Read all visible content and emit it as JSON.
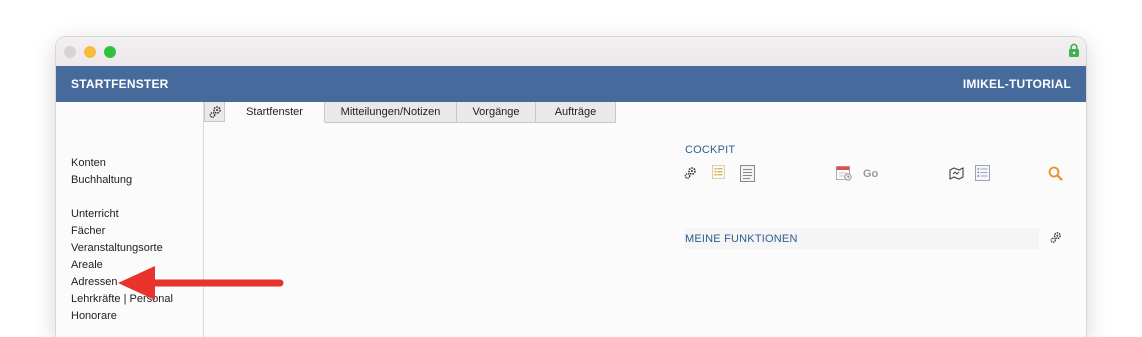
{
  "window": {
    "header_title": "STARTFENSTER",
    "header_user": "IMIKEL-TUTORIAL"
  },
  "sidebar": {
    "items": [
      {
        "label": "Konten"
      },
      {
        "label": "Buchhaltung"
      },
      {
        "label": "Unterricht"
      },
      {
        "label": "Fächer"
      },
      {
        "label": "Veranstaltungsorte"
      },
      {
        "label": "Areale"
      },
      {
        "label": "Adressen"
      },
      {
        "label": "Lehrkräfte | Personal"
      },
      {
        "label": "Honorare"
      }
    ]
  },
  "tabs": [
    {
      "label": "Startfenster",
      "active": true
    },
    {
      "label": "Mitteilungen/Notizen",
      "active": false
    },
    {
      "label": "Vorgänge",
      "active": false
    },
    {
      "label": "Aufträge",
      "active": false
    }
  ],
  "cockpit": {
    "title": "COCKPIT",
    "go_label": "Go",
    "icons": [
      "gear-icon",
      "list-icon",
      "document-icon",
      "calendar-icon",
      "map-icon",
      "table-list-icon",
      "search-icon"
    ]
  },
  "functions": {
    "title": "MEINE FUNKTIONEN",
    "icons": [
      "gear-icon"
    ]
  },
  "colors": {
    "header_bg": "#466a9c",
    "section_title": "#2f5d8f",
    "search_icon": "#e8912c",
    "annotation_arrow": "#e8322b"
  }
}
